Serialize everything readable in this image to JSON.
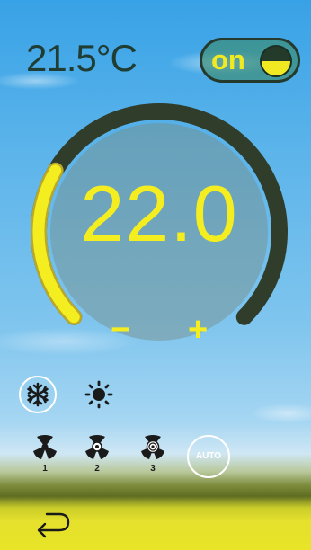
{
  "status": {
    "current_temperature": "21.5°C"
  },
  "power": {
    "label": "on",
    "is_on": true
  },
  "thermostat": {
    "setpoint": "22.0",
    "setpoint_value": 22.0,
    "dial_fill_fraction": 0.28,
    "decrease_label": "−",
    "increase_label": "+"
  },
  "modes": {
    "cool_icon": "snowflake-icon",
    "heat_icon": "sun-icon",
    "selected": "cool"
  },
  "fan": {
    "speeds": [
      {
        "label": "1",
        "icon": "fan-icon"
      },
      {
        "label": "2",
        "icon": "fan-icon"
      },
      {
        "label": "3",
        "icon": "fan-icon"
      }
    ],
    "auto_label": "AUTO"
  },
  "nav": {
    "back_icon": "back-arrow-icon"
  },
  "colors": {
    "accent_yellow": "#f4ee20",
    "dark_green": "#243a2a",
    "text_dark": "#1f3d33"
  }
}
